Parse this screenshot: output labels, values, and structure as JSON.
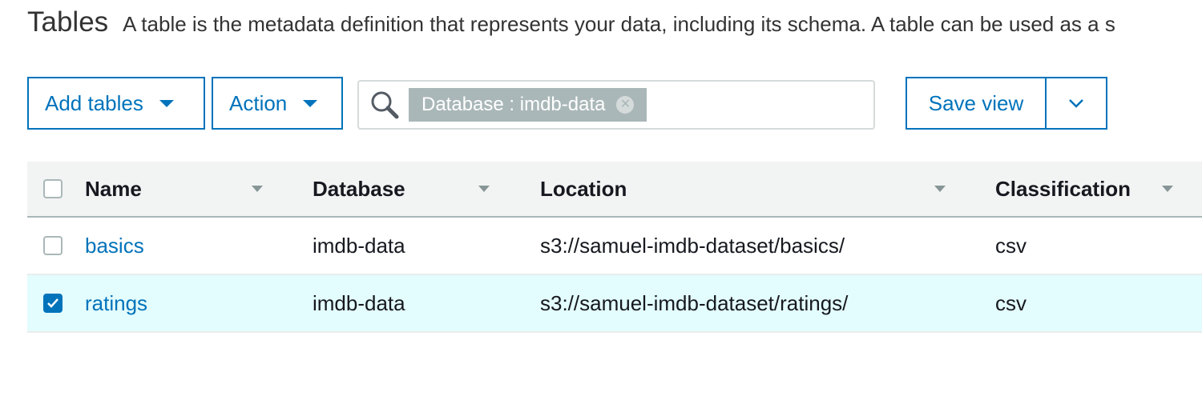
{
  "header": {
    "title": "Tables",
    "description": "A table is the metadata definition that represents your data, including its schema. A table can be used as a s"
  },
  "toolbar": {
    "add_tables_label": "Add tables",
    "action_label": "Action",
    "search_token": "Database : imdb-data",
    "save_view_label": "Save view"
  },
  "table": {
    "columns": [
      "Name",
      "Database",
      "Location",
      "Classification"
    ],
    "rows": [
      {
        "name": "basics",
        "database": "imdb-data",
        "location": "s3://samuel-imdb-dataset/basics/",
        "classification": "csv",
        "selected": false
      },
      {
        "name": "ratings",
        "database": "imdb-data",
        "location": "s3://samuel-imdb-dataset/ratings/",
        "classification": "csv",
        "selected": true
      }
    ]
  },
  "colors": {
    "accent": "#0073bb",
    "selected_row": "#e3fcfd",
    "header_bg": "#f2f3f3",
    "token_bg": "#aab7b8"
  }
}
